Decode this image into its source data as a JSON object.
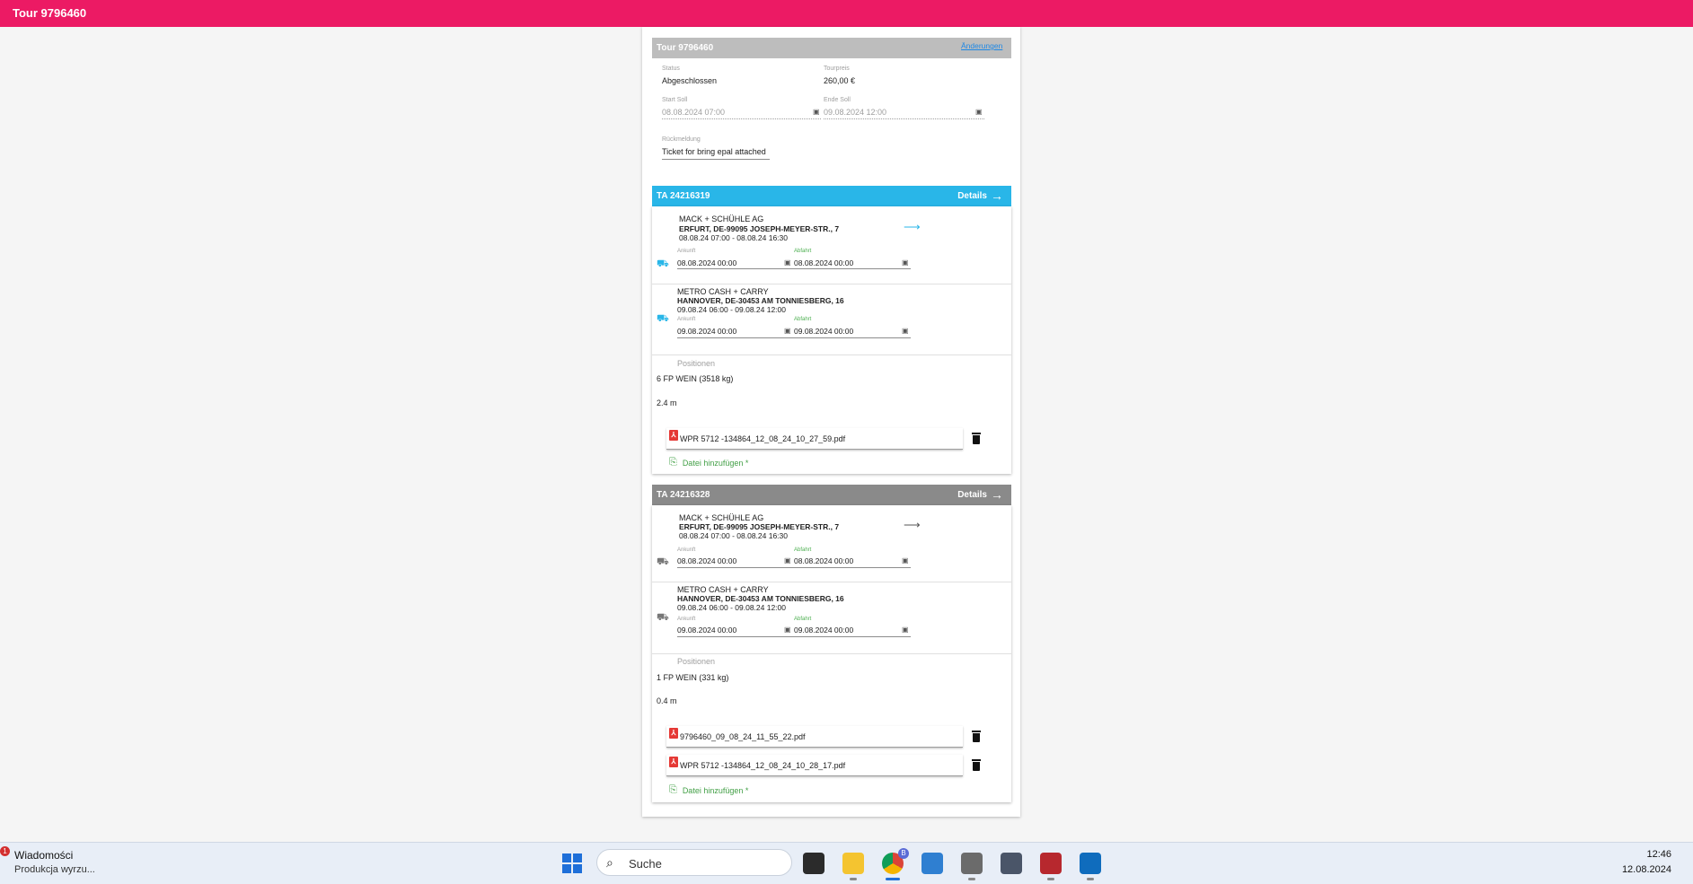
{
  "app": {
    "title": "Tour 9796460"
  },
  "tour": {
    "header": "Tour 9796460",
    "edit_link": "Änderungen",
    "status_label": "Status",
    "status_value": "Abgeschlossen",
    "price_label": "Tourpreis",
    "price_value": "260,00 €",
    "start_label": "Start Soll",
    "start_value": "08.08.2024 07:00",
    "end_label": "Ende Soll",
    "end_value": "09.08.2024 12:00",
    "feedback_label": "Rückmeldung",
    "feedback_value": "Ticket for bring epal attached",
    "header_color": "#bdbdbd"
  },
  "orders": [
    {
      "id": "TA 24216319",
      "details_label": "Details",
      "header_color": "#29b6e8",
      "icon_color": "#29b6e8",
      "pickup": {
        "name": "MACK + SCHÜHLE AG",
        "address": "ERFURT, DE-99095 JOSEPH-MEYER-STR., 7",
        "window": "08.08.24 07:00 - 08.08.24 16:30",
        "arrival_label": "Ankunft",
        "arrival_value": "08.08.2024 00:00",
        "departure_label": "Abfahrt",
        "departure_value": "08.08.2024 00:00"
      },
      "delivery": {
        "name": "METRO CASH + CARRY",
        "address": "HANNOVER, DE-30453 AM TONNIESBERG, 16",
        "window": "09.08.24 06:00 - 09.08.24 12:00",
        "arrival_label": "Ankunft",
        "arrival_value": "09.08.2024 00:00",
        "departure_label": "Abfahrt",
        "departure_value": "09.08.2024 00:00"
      },
      "positions_label": "Positionen",
      "position_line": "6 FP WEIN (3518 kg)",
      "length": "2.4 m",
      "files": [
        "WPR 5712 -134864_12_08_24_10_27_59.pdf"
      ],
      "add_file_label": "Datei hinzufügen *"
    },
    {
      "id": "TA 24216328",
      "details_label": "Details",
      "header_color": "#8a8a8a",
      "icon_color": "#8a8a8a",
      "pickup": {
        "name": "MACK + SCHÜHLE AG",
        "address": "ERFURT, DE-99095 JOSEPH-MEYER-STR., 7",
        "window": "08.08.24 07:00 - 08.08.24 16:30",
        "arrival_label": "Ankunft",
        "arrival_value": "08.08.2024 00:00",
        "departure_label": "Abfahrt",
        "departure_value": "08.08.2024 00:00"
      },
      "delivery": {
        "name": "METRO CASH + CARRY",
        "address": "HANNOVER, DE-30453 AM TONNIESBERG, 16",
        "window": "09.08.24 06:00 - 09.08.24 12:00",
        "arrival_label": "Ankunft",
        "arrival_value": "09.08.2024 00:00",
        "departure_label": "Abfahrt",
        "departure_value": "09.08.2024 00:00"
      },
      "positions_label": "Positionen",
      "position_line": "1 FP WEIN (331 kg)",
      "length": "0.4 m",
      "files": [
        "9796460_09_08_24_11_55_22.pdf",
        "WPR 5712 -134864_12_08_24_10_28_17.pdf"
      ],
      "add_file_label": "Datei hinzufügen *"
    }
  ],
  "taskbar": {
    "notification_count": "1",
    "notification_title": "Wiadomości",
    "notification_sub": "Produkcja wyrzu...",
    "search_placeholder": "Suche",
    "chrome_badge": "B",
    "time": "12:46",
    "date": "12.08.2024"
  },
  "icons": {
    "pdf": "pdf-icon",
    "trash": "trash-icon",
    "clip": "paperclip-icon",
    "truck": "truck-icon",
    "calendar": "calendar-icon",
    "arrow": "arrow-right-icon"
  }
}
